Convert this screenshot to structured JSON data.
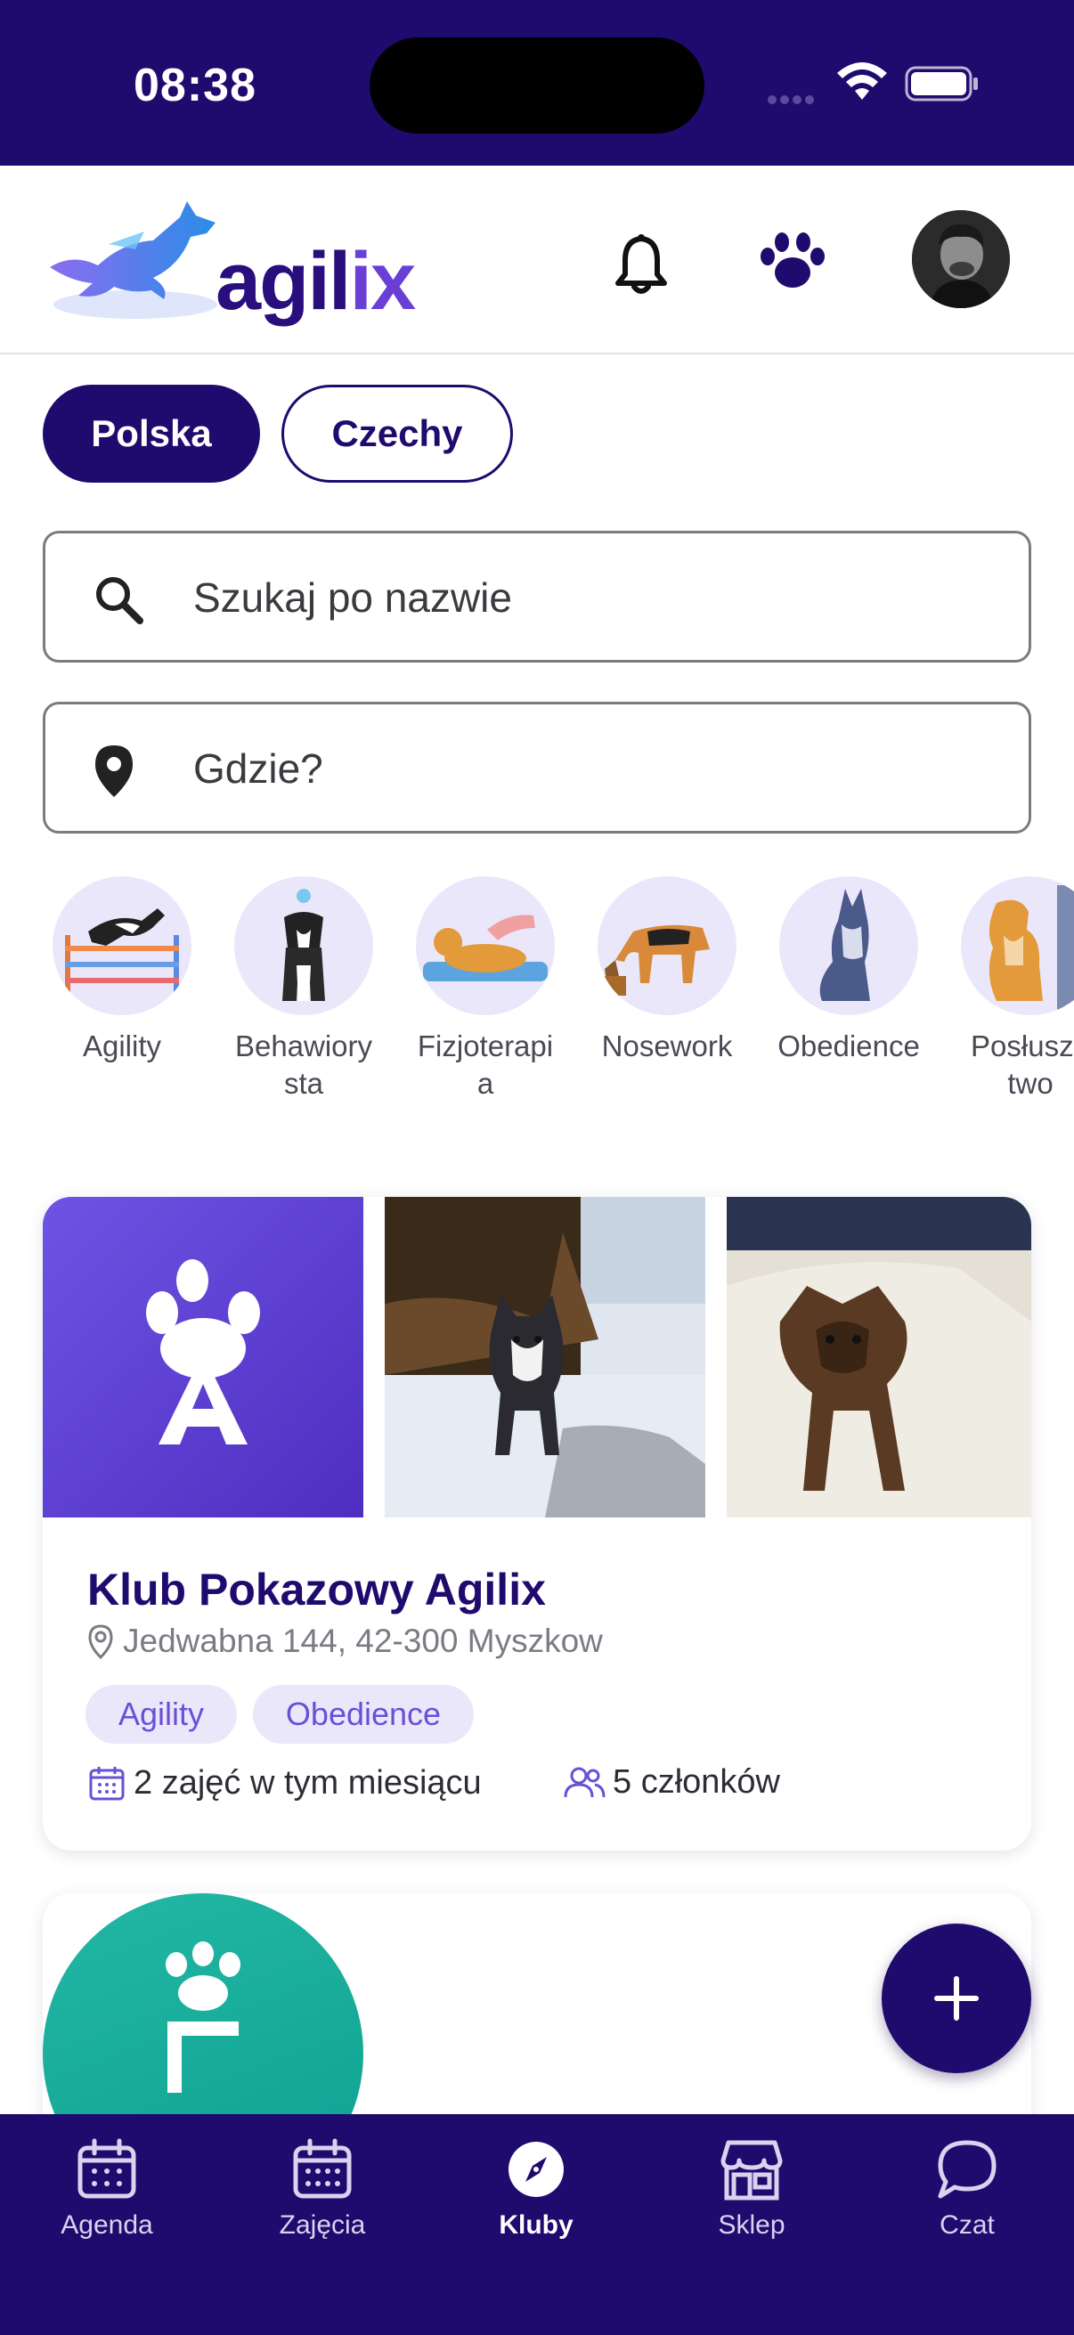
{
  "status_bar": {
    "time": "08:38"
  },
  "header": {
    "logo_text_main": "agil",
    "logo_text_accent": "ix",
    "icons": [
      "dog-logo-icon",
      "bell-icon",
      "paw-icon",
      "avatar"
    ]
  },
  "country_chips": [
    {
      "label": "Polska",
      "selected": true
    },
    {
      "label": "Czechy",
      "selected": false
    }
  ],
  "search": {
    "name_placeholder": "Szukaj po nazwie",
    "location_placeholder": "Gdzie?"
  },
  "categories": [
    {
      "label": "Agility"
    },
    {
      "label": "Behawiory\nsta"
    },
    {
      "label": "Fizjoterapi\na"
    },
    {
      "label": "Nosework"
    },
    {
      "label": "Obedience"
    },
    {
      "label": "Posłusze\ntwo"
    }
  ],
  "club": {
    "name": "Klub Pokazowy Agilix",
    "address": "Jedwabna 144, 42-300 Myszkow",
    "tags": [
      "Agility",
      "Obedience"
    ],
    "sessions": "2 zajęć w tym miesiącu",
    "members": "5 członków"
  },
  "tabbar": {
    "items": [
      {
        "label": "Agenda",
        "icon": "calendar-icon",
        "active": false
      },
      {
        "label": "Zajęcia",
        "icon": "calendar-grid-icon",
        "active": false
      },
      {
        "label": "Kluby",
        "icon": "compass-icon",
        "active": true
      },
      {
        "label": "Sklep",
        "icon": "store-icon",
        "active": false
      },
      {
        "label": "Czat",
        "icon": "chat-bubble-icon",
        "active": false
      }
    ]
  },
  "colors": {
    "brand_dark": "#1f0a6e",
    "brand_accent": "#6a3fd6",
    "tag_bg": "#ebe7fb"
  }
}
